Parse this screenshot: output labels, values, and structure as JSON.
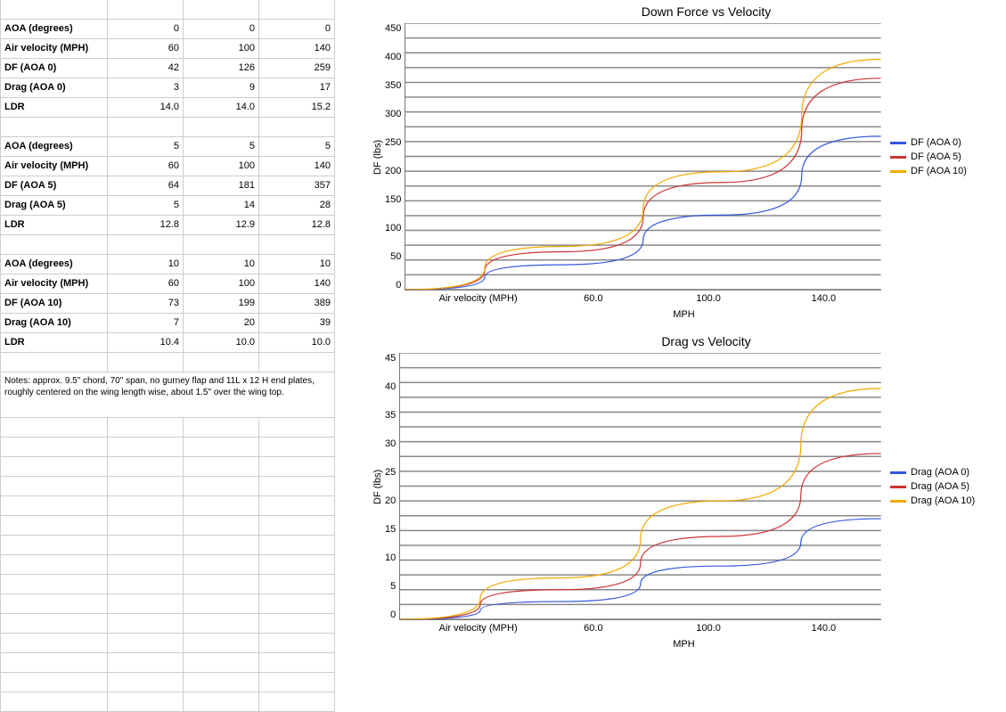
{
  "tables": {
    "block0": {
      "rows": [
        {
          "label": "AOA (degrees)",
          "v": [
            "0",
            "0",
            "0"
          ]
        },
        {
          "label": "Air velocity (MPH)",
          "v": [
            "60",
            "100",
            "140"
          ]
        },
        {
          "label": "DF (AOA 0)",
          "v": [
            "42",
            "126",
            "259"
          ]
        },
        {
          "label": "Drag (AOA 0)",
          "v": [
            "3",
            "9",
            "17"
          ]
        },
        {
          "label": "LDR",
          "v": [
            "14.0",
            "14.0",
            "15.2"
          ]
        }
      ]
    },
    "block5": {
      "rows": [
        {
          "label": "AOA (degrees)",
          "v": [
            "5",
            "5",
            "5"
          ]
        },
        {
          "label": "Air velocity (MPH)",
          "v": [
            "60",
            "100",
            "140"
          ]
        },
        {
          "label": "DF (AOA 5)",
          "v": [
            "64",
            "181",
            "357"
          ]
        },
        {
          "label": "Drag (AOA 5)",
          "v": [
            "5",
            "14",
            "28"
          ]
        },
        {
          "label": "LDR",
          "v": [
            "12.8",
            "12.9",
            "12.8"
          ]
        }
      ]
    },
    "block10": {
      "rows": [
        {
          "label": "AOA (degrees)",
          "v": [
            "10",
            "10",
            "10"
          ]
        },
        {
          "label": "Air velocity (MPH)",
          "v": [
            "60",
            "100",
            "140"
          ]
        },
        {
          "label": "DF (AOA 10)",
          "v": [
            "73",
            "199",
            "389"
          ]
        },
        {
          "label": "Drag (AOA 10)",
          "v": [
            "7",
            "20",
            "39"
          ]
        },
        {
          "label": "LDR",
          "v": [
            "10.4",
            "10.0",
            "10.0"
          ]
        }
      ]
    }
  },
  "notes": "Notes: approx. 9.5\" chord, 70\" span, no gurney flap and 11L x 12 H end plates, roughly centered on the wing length wise, about 1.5\" over the wing top.",
  "colors": {
    "s0": "#3355dd",
    "s1": "#cc3333",
    "s2": "#f2a900"
  },
  "charts": {
    "downforce": {
      "title": "Down Force vs Velocity",
      "ylabel": "DF (lbs)",
      "xlabel": "MPH",
      "xticks": [
        "Air velocity (MPH)",
        "60.0",
        "100.0",
        "140.0"
      ],
      "yticks": [
        "450",
        "400",
        "350",
        "300",
        "250",
        "200",
        "150",
        "100",
        "50",
        "0"
      ],
      "legend": [
        "DF (AOA 0)",
        "DF (AOA 5)",
        "DF (AOA 10)"
      ]
    },
    "drag": {
      "title": "Drag vs Velocity",
      "ylabel": "DF (lbs)",
      "xlabel": "MPH",
      "xticks": [
        "Air velocity (MPH)",
        "60.0",
        "100.0",
        "140.0"
      ],
      "yticks": [
        "45",
        "40",
        "35",
        "30",
        "25",
        "20",
        "15",
        "10",
        "5",
        "0"
      ],
      "legend": [
        "Drag (AOA 0)",
        "Drag (AOA 5)",
        "Drag (AOA 10)"
      ]
    }
  },
  "chart_data": [
    {
      "type": "line",
      "title": "Down Force vs Velocity",
      "xlabel": "MPH",
      "ylabel": "DF (lbs)",
      "ylim": [
        0,
        450
      ],
      "categories": [
        "Air velocity (MPH)",
        "60.0",
        "100.0",
        "140.0"
      ],
      "series": [
        {
          "name": "DF (AOA 0)",
          "values": [
            0,
            42,
            126,
            259
          ],
          "color": "#3355dd"
        },
        {
          "name": "DF (AOA 5)",
          "values": [
            0,
            64,
            181,
            357
          ],
          "color": "#cc3333"
        },
        {
          "name": "DF (AOA 10)",
          "values": [
            0,
            73,
            199,
            389
          ],
          "color": "#f2a900"
        }
      ]
    },
    {
      "type": "line",
      "title": "Drag vs Velocity",
      "xlabel": "MPH",
      "ylabel": "DF (lbs)",
      "ylim": [
        0,
        45
      ],
      "categories": [
        "Air velocity (MPH)",
        "60.0",
        "100.0",
        "140.0"
      ],
      "series": [
        {
          "name": "Drag (AOA 0)",
          "values": [
            0,
            3,
            9,
            17
          ],
          "color": "#3355dd"
        },
        {
          "name": "Drag (AOA 5)",
          "values": [
            0,
            5,
            14,
            28
          ],
          "color": "#cc3333"
        },
        {
          "name": "Drag (AOA 10)",
          "values": [
            0,
            7,
            20,
            39
          ],
          "color": "#f2a900"
        }
      ]
    }
  ]
}
